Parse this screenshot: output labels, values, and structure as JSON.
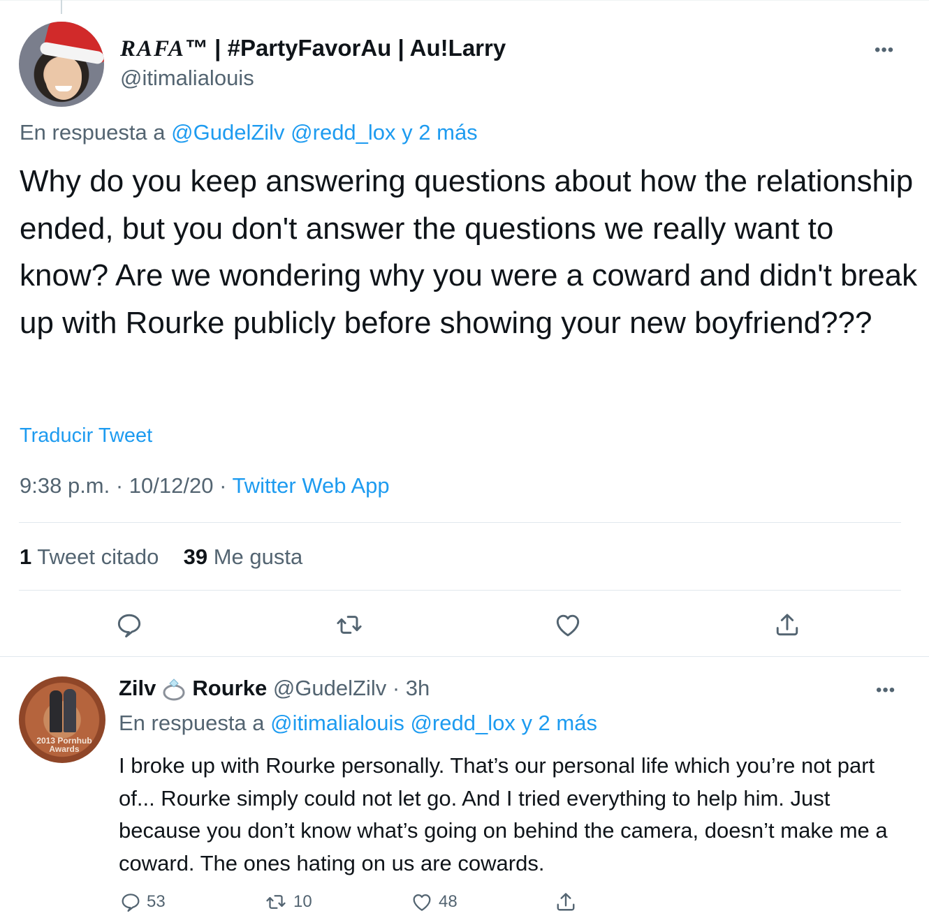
{
  "main_tweet": {
    "author_name": "RAFA™ | #PartyFavorAu | Au!Larry",
    "author_name_fancy": "RAFA",
    "author_name_rest": "™ | #PartyFavorAu | Au!Larry",
    "handle": "@itimalialouis",
    "reply_prefix": "En respuesta a ",
    "reply_mentions": "@GudelZilv @redd_lox y 2 más",
    "text": "Why do you keep answering questions about how the relationship ended, but you don't answer the questions we really want to know? Are we wondering why you were a coward and didn't break up with Rourke publicly before showing your new boyfriend???",
    "translate_label": "Traducir Tweet",
    "time": "9:38 p.m. · 10/12/20 · ",
    "source": "Twitter Web App",
    "quote_count": "1",
    "quote_label": " Tweet citado",
    "like_count": "39",
    "like_label": " Me gusta",
    "more_label": "•••"
  },
  "reply_tweet": {
    "name_first": "Zilv",
    "name_last": "Rourke",
    "handle_time": " @GudelZilv · 3h",
    "reply_prefix": "En respuesta a ",
    "reply_mentions": "@itimalialouis @redd_lox y 2 más",
    "avatar_text": "2013 Pornhub Awards",
    "text": "I broke up with Rourke personally. That’s our personal life which you’re not part of... Rourke simply could not let go. And I tried everything to help him. Just because you don’t know what’s going on behind the camera, doesn’t make me a coward. The ones hating on us are cowards.",
    "reply_count": "53",
    "retweet_count": "10",
    "like_count": "48",
    "more_label": "•••"
  },
  "icons": {
    "reply": "reply-icon",
    "retweet": "retweet-icon",
    "like": "heart-icon",
    "share": "share-icon",
    "ring": "ring-icon"
  },
  "colors": {
    "link": "#1d9bf0",
    "muted": "#536471",
    "text": "#0f1419",
    "divider": "#e1e8ed"
  }
}
